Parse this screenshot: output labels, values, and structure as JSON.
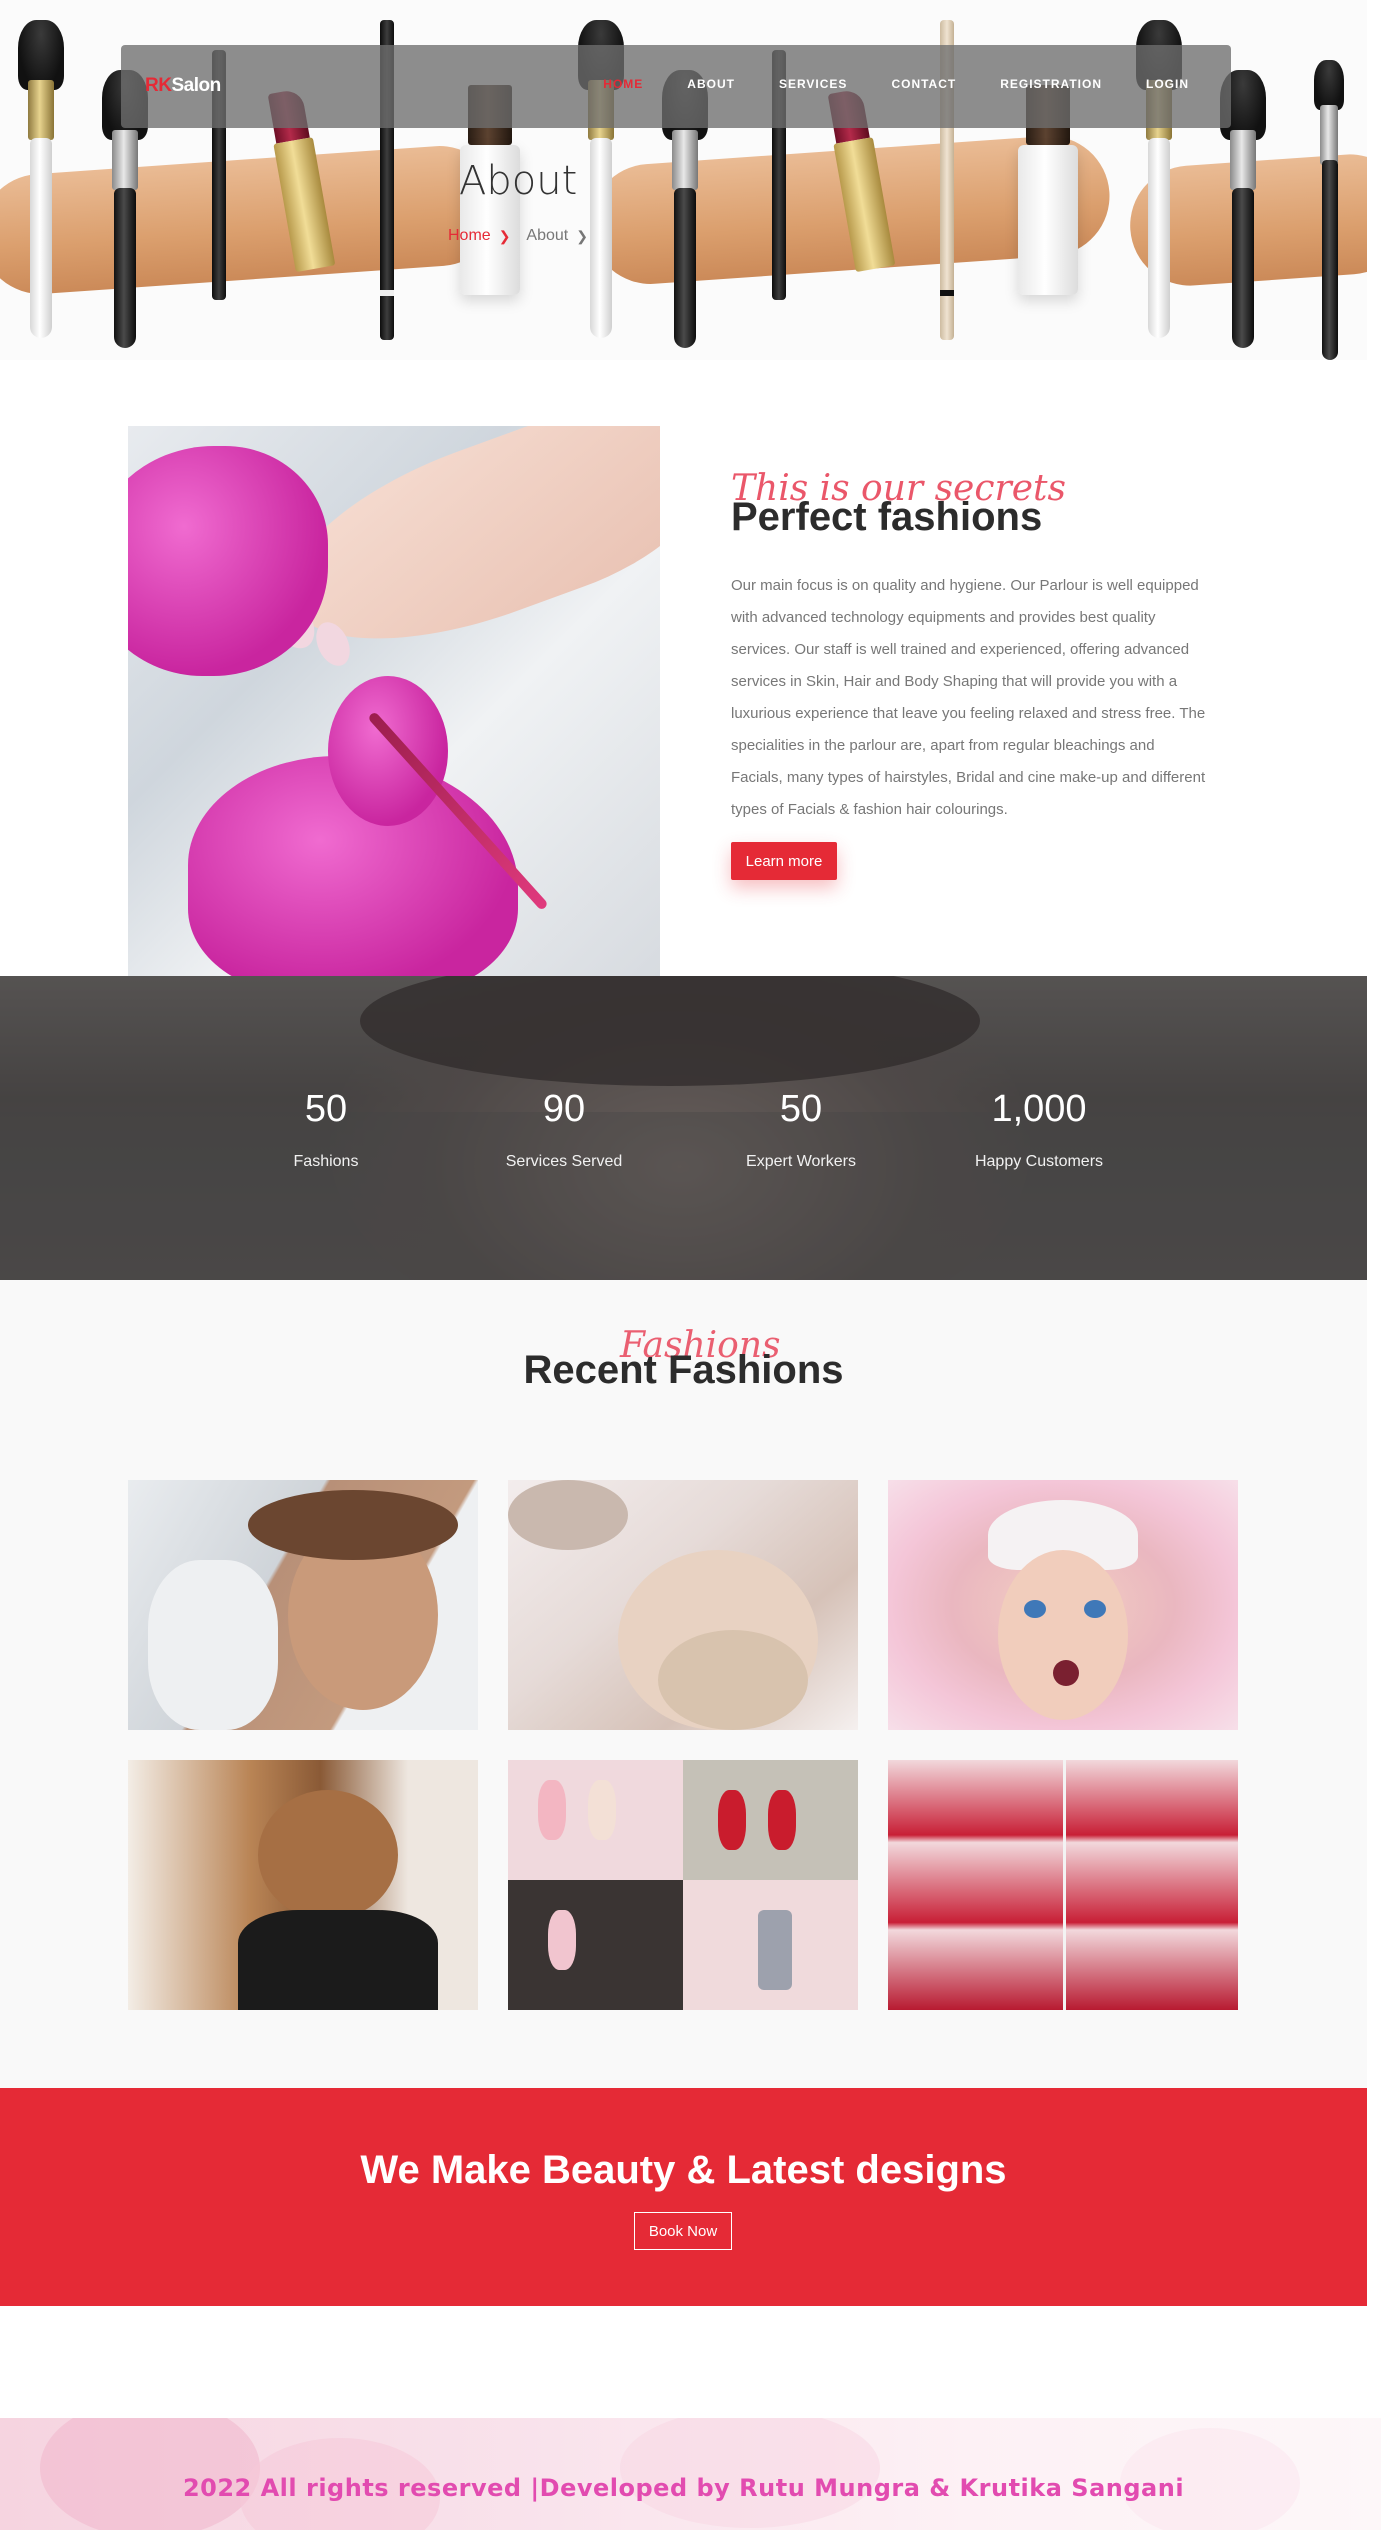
{
  "header": {
    "logo_accent": "RK",
    "logo_rest": "Salon",
    "nav": [
      "HOME",
      "ABOUT",
      "SERVICES",
      "CONTACT",
      "REGISTRATION",
      "LOGIN"
    ],
    "active_nav": "HOME"
  },
  "hero": {
    "title": "About",
    "breadcrumb": {
      "home": "Home",
      "current": "About"
    }
  },
  "about": {
    "script": "This is our secrets",
    "heading": "Perfect fashions",
    "body": "Our main focus is on quality and hygiene. Our Parlour is well equipped with advanced technology equipments and provides best quality services. Our staff is well trained and experienced, offering advanced services in Skin, Hair and Body Shaping that will provide you with a luxurious experience that leave you feeling relaxed and stress free. The specialities in the parlour are, apart from regular bleachings and Facials, many types of hairstyles, Bridal and cine make-up and different types of Facials & fashion hair colourings.",
    "button": "Learn more"
  },
  "stats": [
    {
      "value": "50",
      "label": "Fashions"
    },
    {
      "value": "90",
      "label": "Services Served"
    },
    {
      "value": "50",
      "label": "Expert Workers"
    },
    {
      "value": "1,000",
      "label": "Happy Customers"
    }
  ],
  "fashions": {
    "script": "Fashions",
    "heading": "Recent Fashions"
  },
  "cta": {
    "title": "We Make Beauty & Latest designs",
    "button": "Book Now"
  },
  "footer": {
    "text": "2022 All rights reserved |Developed by Rutu Mungra & Krutika Sangani"
  },
  "colors": {
    "accent": "#e52a36",
    "footer_text": "#e24bb0"
  }
}
